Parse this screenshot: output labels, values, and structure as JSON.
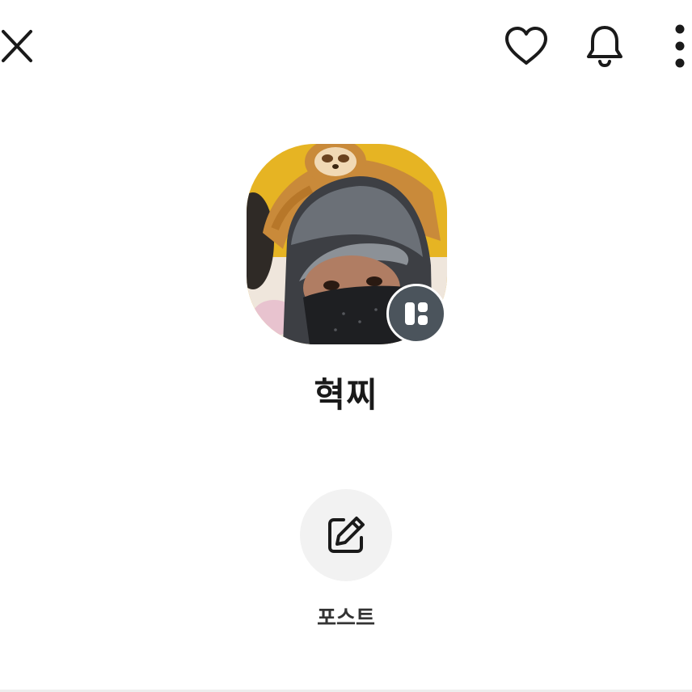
{
  "header": {
    "icons": [
      "close-icon",
      "heart-icon",
      "bell-icon",
      "more-vertical-icon"
    ]
  },
  "profile": {
    "name": "혁찌",
    "badge_icon": "profile-layout-icon"
  },
  "actions": {
    "post_label": "포스트",
    "post_icon": "edit-icon"
  },
  "colors": {
    "background": "#ffffff",
    "text": "#1a1a1a",
    "badge": "#4b545c",
    "action_circle": "#f2f2f2"
  }
}
